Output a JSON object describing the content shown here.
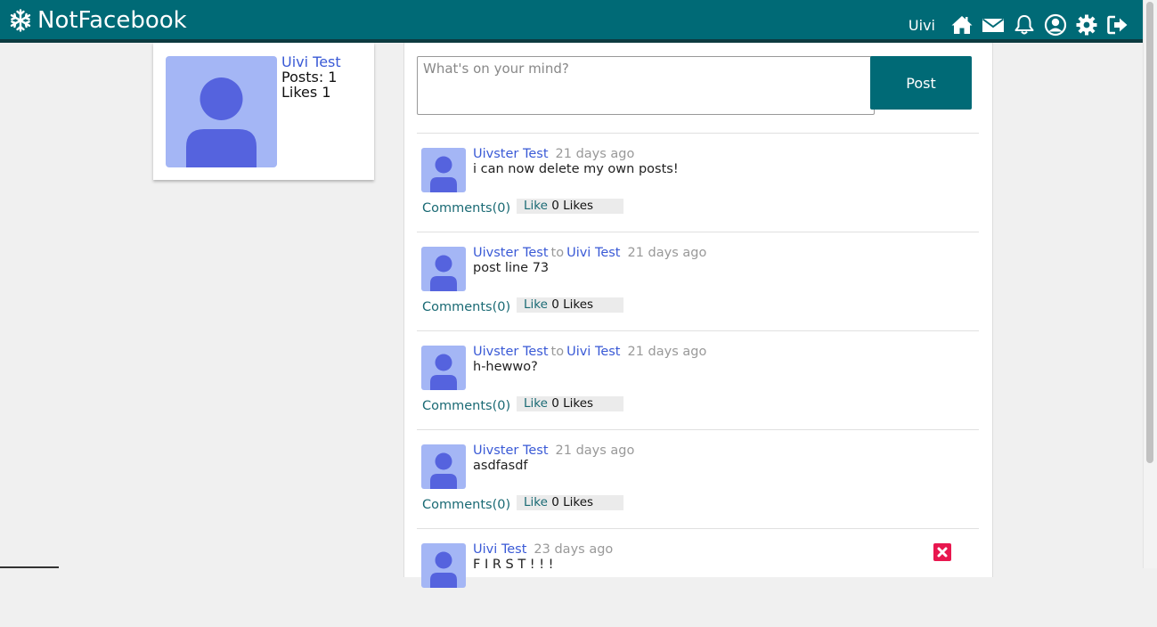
{
  "header": {
    "brand": "NotFacebook",
    "user": "Uivi"
  },
  "profile": {
    "name": "Uivi Test",
    "posts": "Posts: 1",
    "likes": "Likes 1"
  },
  "composer": {
    "placeholder": "What's on your mind?",
    "post_label": "Post"
  },
  "posts": [
    {
      "author": "Uivster Test",
      "to": "",
      "target": "",
      "time": "21 days ago",
      "body": "i can now delete my own posts!",
      "comments": "Comments(0)",
      "like": "Like",
      "likes": "0 Likes"
    },
    {
      "author": "Uivster Test",
      "to": "to",
      "target": "Uivi Test",
      "time": "21 days ago",
      "body": "post line 73",
      "comments": "Comments(0)",
      "like": "Like",
      "likes": "0 Likes"
    },
    {
      "author": "Uivster Test",
      "to": "to",
      "target": "Uivi Test",
      "time": "21 days ago",
      "body": "h-hewwo?",
      "comments": "Comments(0)",
      "like": "Like",
      "likes": "0 Likes"
    },
    {
      "author": "Uivster Test",
      "to": "",
      "target": "",
      "time": "21 days ago",
      "body": "asdfasdf",
      "comments": "Comments(0)",
      "like": "Like",
      "likes": "0 Likes"
    },
    {
      "author": "Uivi Test",
      "to": "",
      "target": "",
      "time": "23 days ago",
      "body": "F I R S T ! ! !",
      "comments": "",
      "like": "",
      "likes": ""
    }
  ],
  "colors": {
    "brand": "#006a76",
    "link": "#3a5ad6",
    "avatar_bg": "#a4b6f5",
    "avatar_fg": "#5563de",
    "delete": "#e8174f"
  },
  "icons": {
    "brand": "snowflake-icon",
    "nav": [
      "home-icon",
      "mail-icon",
      "bell-icon",
      "user-circle-icon",
      "gear-icon",
      "logout-icon"
    ],
    "delete": "close-icon"
  }
}
